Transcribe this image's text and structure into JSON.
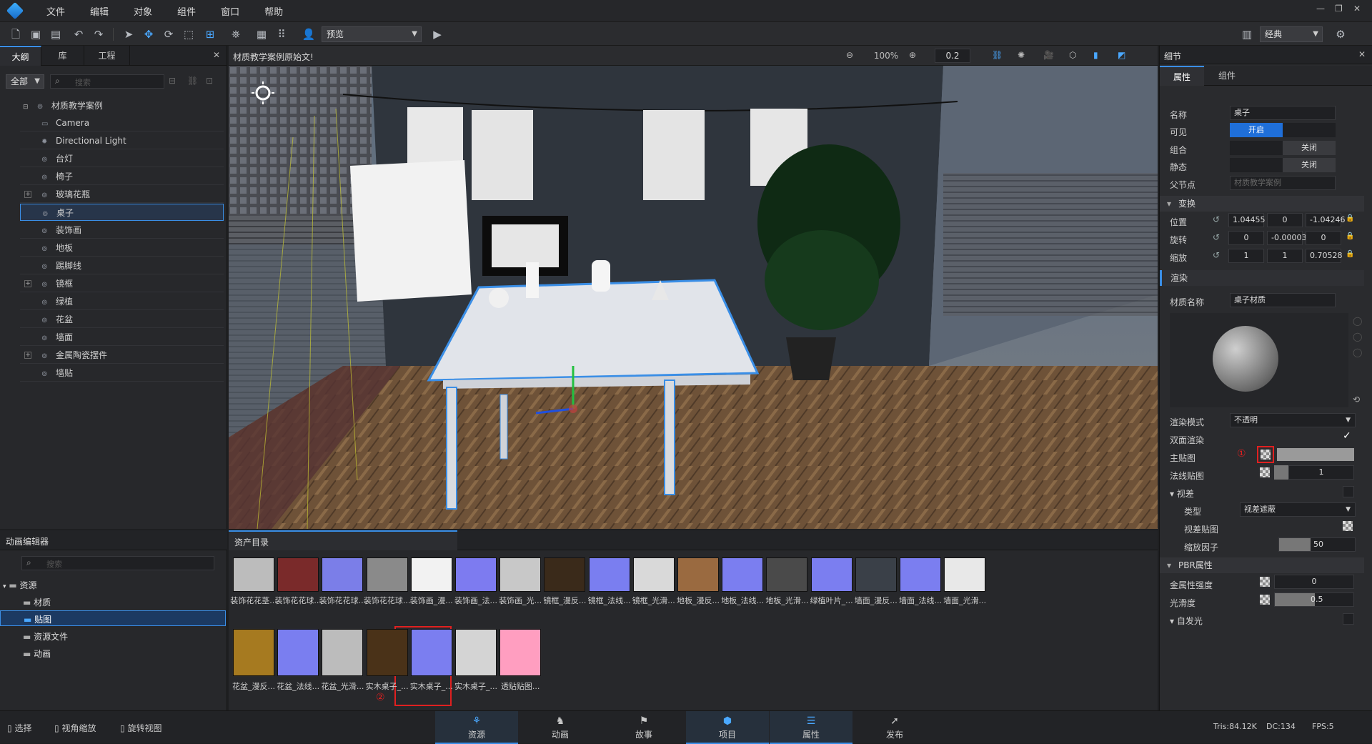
{
  "menubar": {
    "items": [
      "文件",
      "编辑",
      "对象",
      "组件",
      "窗口",
      "帮助"
    ]
  },
  "toolbar": {
    "mode_select": "预览",
    "layout_select": "经典",
    "zoom": "100%",
    "step": "0.2"
  },
  "outline": {
    "tabs": [
      "大纲",
      "库",
      "工程"
    ],
    "filter": "全部",
    "search_placeholder": "搜索",
    "root": "材质教学案例",
    "items": [
      "Camera",
      "Directional Light",
      "台灯",
      "椅子",
      "玻璃花瓶",
      "桌子",
      "装饰画",
      "地板",
      "踢脚线",
      "镜框",
      "绿植",
      "花盆",
      "墙面",
      "金属陶瓷摆件",
      "墙贴"
    ]
  },
  "viewport": {
    "title": "材质教学案例原始文!"
  },
  "details": {
    "title": "细节",
    "tabs": [
      "属性",
      "组件"
    ],
    "name_label": "名称",
    "name_value": "桌子",
    "visible_label": "可见",
    "visible_value": "开启",
    "group_label": "组合",
    "group_value": "关闭",
    "static_label": "静态",
    "static_value": "关闭",
    "parent_label": "父节点",
    "parent_value": "材质教学案例",
    "transform_section": "变换",
    "position_label": "位置",
    "position": [
      "1.04455",
      "0",
      "-1.04246"
    ],
    "rotation_label": "旋转",
    "rotation": [
      "0",
      "-0.00003",
      "0"
    ],
    "scale_label": "缩放",
    "scale": [
      "1",
      "1",
      "0.70528"
    ],
    "render_section": "渲染",
    "material_label": "材质名称",
    "material_value": "桌子材质",
    "render_mode_label": "渲染模式",
    "render_mode_value": "不透明",
    "double_sided_label": "双面渲染",
    "main_map_label": "主贴图",
    "normal_map_label": "法线贴图",
    "normal_map_value": "1",
    "parallax_section": "视差",
    "type_label": "类型",
    "type_value": "视差遮蔽",
    "parallax_map_label": "视差贴图",
    "scale_factor_label": "缩放因子",
    "scale_factor_value": "50",
    "pbr_section": "PBR属性",
    "metal_label": "金属性强度",
    "metal_value": "0",
    "smooth_label": "光滑度",
    "smooth_value": "0.5",
    "emissive_section": "自发光",
    "callout1": "①"
  },
  "anim_editor": {
    "title": "动画编辑器",
    "search_placeholder": "搜索",
    "tree": [
      "资源",
      "材质",
      "贴图",
      "资源文件",
      "动画"
    ]
  },
  "assets": {
    "title": "资产目录",
    "callout2": "②",
    "row1": [
      "装饰花花茎...",
      "装饰花花球...",
      "装饰花花球...",
      "装饰花花球...",
      "装饰画_漫...",
      "装饰画_法...",
      "装饰画_光...",
      "镜框_漫反...",
      "镜框_法线...",
      "镜框_光滑...",
      "地板_漫反...",
      "地板_法线...",
      "地板_光滑...",
      "绿植叶片_...",
      "墙面_漫反...",
      "墙面_法线...",
      "墙面_光滑..."
    ],
    "row2": [
      "花盆_漫反...",
      "花盆_法线...",
      "花盆_光滑...",
      "实木桌子_...",
      "实木桌子_...",
      "实木桌子_...",
      "透贴贴图..."
    ]
  },
  "statusbar": {
    "left": [
      "选择",
      "视角缩放",
      "旋转视图"
    ],
    "tabs": [
      "资源",
      "动画",
      "故事",
      "项目",
      "属性",
      "发布"
    ],
    "tris": "Tris:84.12K",
    "dc": "DC:134",
    "fps": "FPS:5"
  },
  "colors": {
    "accent": "#3a8ee6",
    "toggle_on": "#1f6fd9",
    "callout": "#e02020"
  }
}
